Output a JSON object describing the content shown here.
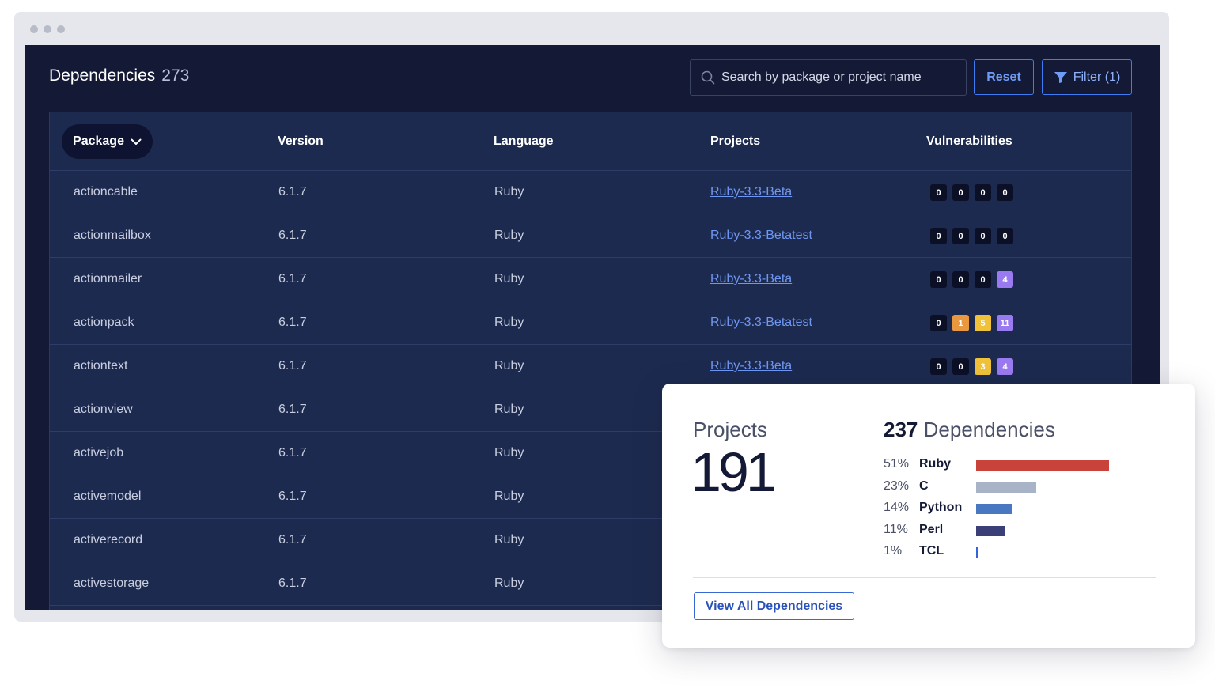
{
  "header": {
    "title": "Dependencies",
    "count": "273",
    "search_placeholder": "Search by package or project name",
    "reset_label": "Reset",
    "filter_label": "Filter (1)"
  },
  "table": {
    "columns": {
      "package": "Package",
      "version": "Version",
      "language": "Language",
      "projects": "Projects",
      "vulnerabilities": "Vulnerabilities"
    },
    "rows": [
      {
        "package": "actioncable",
        "version": "6.1.7",
        "language": "Ruby",
        "project": "Ruby-3.3-Beta",
        "vulns": [
          {
            "v": "0",
            "c": "dark"
          },
          {
            "v": "0",
            "c": "dark"
          },
          {
            "v": "0",
            "c": "dark"
          },
          {
            "v": "0",
            "c": "dark"
          }
        ]
      },
      {
        "package": "actionmailbox",
        "version": "6.1.7",
        "language": "Ruby",
        "project": "Ruby-3.3-Betatest",
        "vulns": [
          {
            "v": "0",
            "c": "dark"
          },
          {
            "v": "0",
            "c": "dark"
          },
          {
            "v": "0",
            "c": "dark"
          },
          {
            "v": "0",
            "c": "dark"
          }
        ]
      },
      {
        "package": "actionmailer",
        "version": "6.1.7",
        "language": "Ruby",
        "project": "Ruby-3.3-Beta",
        "vulns": [
          {
            "v": "0",
            "c": "dark"
          },
          {
            "v": "0",
            "c": "dark"
          },
          {
            "v": "0",
            "c": "dark"
          },
          {
            "v": "4",
            "c": "purple"
          }
        ]
      },
      {
        "package": "actionpack",
        "version": "6.1.7",
        "language": "Ruby",
        "project": "Ruby-3.3-Betatest",
        "vulns": [
          {
            "v": "0",
            "c": "dark"
          },
          {
            "v": "1",
            "c": "orange"
          },
          {
            "v": "5",
            "c": "yellow"
          },
          {
            "v": "11",
            "c": "purple"
          }
        ]
      },
      {
        "package": "actiontext",
        "version": "6.1.7",
        "language": "Ruby",
        "project": "Ruby-3.3-Beta",
        "vulns": [
          {
            "v": "0",
            "c": "dark"
          },
          {
            "v": "0",
            "c": "dark"
          },
          {
            "v": "3",
            "c": "yellow"
          },
          {
            "v": "4",
            "c": "purple"
          }
        ]
      },
      {
        "package": "actionview",
        "version": "6.1.7",
        "language": "Ruby",
        "project": "",
        "vulns": []
      },
      {
        "package": "activejob",
        "version": "6.1.7",
        "language": "Ruby",
        "project": "",
        "vulns": []
      },
      {
        "package": "activemodel",
        "version": "6.1.7",
        "language": "Ruby",
        "project": "",
        "vulns": []
      },
      {
        "package": "activerecord",
        "version": "6.1.7",
        "language": "Ruby",
        "project": "",
        "vulns": []
      },
      {
        "package": "activestorage",
        "version": "6.1.7",
        "language": "Ruby",
        "project": "",
        "vulns": []
      }
    ]
  },
  "summary": {
    "projects_label": "Projects",
    "projects_count": "191",
    "deps_count": "237",
    "deps_label": "Dependencies",
    "languages": [
      {
        "pct": "51%",
        "name": "Ruby",
        "value": 51,
        "color": "#c8443a"
      },
      {
        "pct": "23%",
        "name": "C",
        "value": 23,
        "color": "#a9b3c8"
      },
      {
        "pct": "14%",
        "name": "Python",
        "value": 14,
        "color": "#4a78c0"
      },
      {
        "pct": "11%",
        "name": "Perl",
        "value": 11,
        "color": "#3a3f78"
      },
      {
        "pct": "1%",
        "name": "TCL",
        "value": 1,
        "color": "#3563d9"
      }
    ],
    "view_all_label": "View All Dependencies"
  },
  "colors": {
    "background": "#141936",
    "table": "#1d2a4f",
    "accent": "#3f7bf2",
    "vuln_orange": "#e8993f",
    "vuln_yellow": "#f0c23a",
    "vuln_purple": "#9a7af0"
  }
}
